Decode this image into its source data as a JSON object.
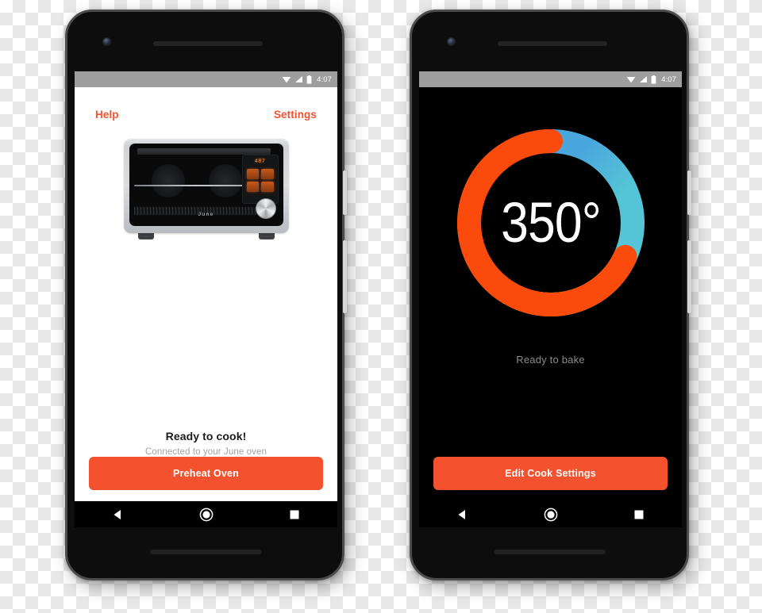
{
  "status_bar": {
    "time": "4:07",
    "icons": [
      "wifi-icon",
      "signal-icon",
      "battery-icon"
    ]
  },
  "nav_bar": {
    "back_label": "back-button",
    "home_label": "home-button",
    "recents_label": "recents-button"
  },
  "colors": {
    "accent": "#f4522e",
    "status_bar": "#9e9e9e",
    "dial_active": "#fa4a0c",
    "caption": "#8c8c8c",
    "subtitle": "#a3a3a3"
  },
  "screen_ready": {
    "header": {
      "help_label": "Help",
      "settings_label": "Settings"
    },
    "oven": {
      "brand": "June",
      "display_readout": "487"
    },
    "status_title": "Ready to cook!",
    "status_subtitle": "Connected to your June oven",
    "cta_label": "Preheat Oven"
  },
  "screen_temperature": {
    "dial": {
      "value": "350°",
      "temperature": 350,
      "unit": "°F",
      "arc_sweep_degrees": 254,
      "gradient_stops": [
        {
          "at_deg": 0,
          "color": "#fa4a0c"
        },
        {
          "at_deg": 38,
          "color": "#4aa7dd"
        },
        {
          "at_deg": 90,
          "color": "#57c8d8"
        },
        {
          "at_deg": 135,
          "color": "#7fd8a8"
        },
        {
          "at_deg": 170,
          "color": "#c3e46a"
        },
        {
          "at_deg": 200,
          "color": "#ffe814"
        },
        {
          "at_deg": 240,
          "color": "#ffb318"
        },
        {
          "at_deg": 285,
          "color": "#ff7a10"
        },
        {
          "at_deg": 330,
          "color": "#fa4a0c"
        },
        {
          "at_deg": 360,
          "color": "#fa4a0c"
        }
      ]
    },
    "caption": "Ready to bake",
    "cta_label": "Edit Cook Settings"
  }
}
